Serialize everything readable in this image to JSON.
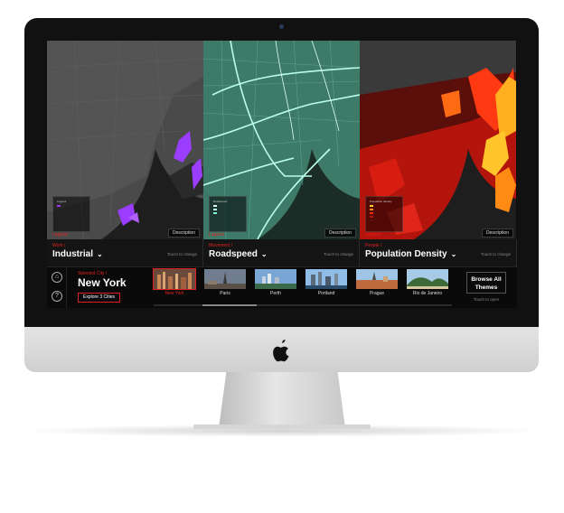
{
  "device": {
    "brand_icon": "apple-logo-icon"
  },
  "maps": [
    {
      "category": "Work /",
      "theme": "Industrial",
      "legend_link": "Legend",
      "legend_title": "Legend",
      "description_label": "Description",
      "touch_label": "Touch to change",
      "accent": "#9b3dff"
    },
    {
      "category": "Movement /",
      "theme": "Roadspeed",
      "legend_link": "Legend",
      "legend_title": "Roadspeed",
      "description_label": "Description",
      "touch_label": "Touch to change",
      "accent": "#7cf5d4"
    },
    {
      "category": "People /",
      "theme": "Population Density",
      "legend_link": "Legend",
      "legend_title": "Population density",
      "description_label": "Description",
      "touch_label": "Touch to change",
      "accent": "#ff2a10"
    }
  ],
  "bottom": {
    "home_icon": "home-icon",
    "help_icon": "help-icon",
    "selected_label": "Selected City /",
    "city_name": "New York",
    "explore_label": "Explore 3 Cities",
    "cities": [
      "New York",
      "Paris",
      "Perth",
      "Portland",
      "Prague",
      "Rio de Janeiro"
    ],
    "browse_label": "Browse All Themes",
    "touch_open_label": "Touch to open"
  },
  "colors": {
    "accent_red": "#e02020"
  }
}
